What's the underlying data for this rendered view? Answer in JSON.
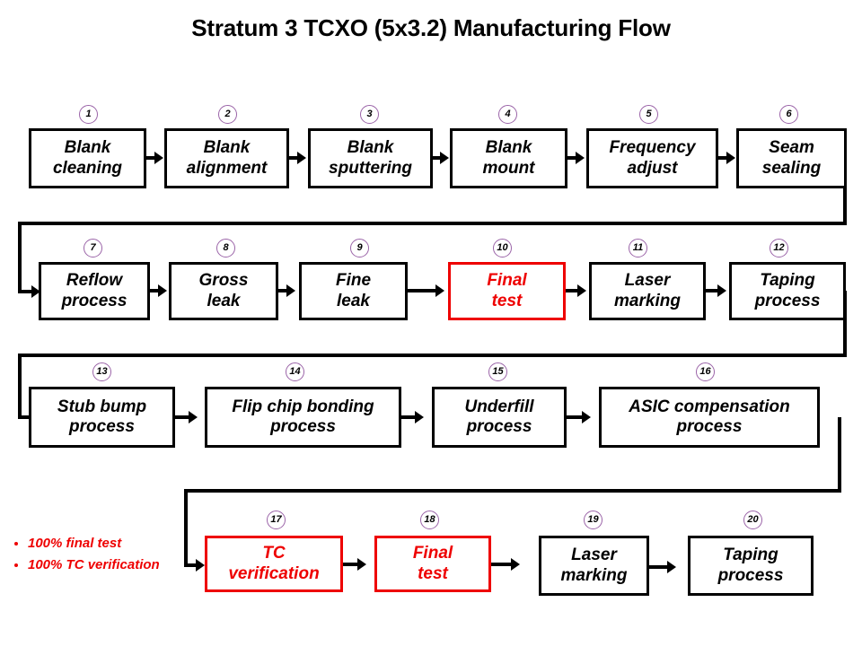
{
  "title": "Stratum 3 TCXO (5x3.2) Manufacturing Flow",
  "colors": {
    "box_border": "#000000",
    "highlight_border": "#ee0000",
    "highlight_text": "#ee0000",
    "step_circle": "#9b64a8",
    "note_text": "#ee0000",
    "connector": "#000000"
  },
  "rows": [
    {
      "id": "row-1",
      "steps": [
        {
          "num": "1",
          "label": "Blank\ncleaning",
          "highlight": false
        },
        {
          "num": "2",
          "label": "Blank\nalignment",
          "highlight": false
        },
        {
          "num": "3",
          "label": "Blank\nsputtering",
          "highlight": false
        },
        {
          "num": "4",
          "label": "Blank\nmount",
          "highlight": false
        },
        {
          "num": "5",
          "label": "Frequency\nadjust",
          "highlight": false
        },
        {
          "num": "6",
          "label": "Seam\nsealing",
          "highlight": false
        }
      ]
    },
    {
      "id": "row-2",
      "steps": [
        {
          "num": "7",
          "label": "Reflow\nprocess",
          "highlight": false
        },
        {
          "num": "8",
          "label": "Gross\nleak",
          "highlight": false
        },
        {
          "num": "9",
          "label": "Fine\nleak",
          "highlight": false
        },
        {
          "num": "10",
          "label": "Final\ntest",
          "highlight": true
        },
        {
          "num": "11",
          "label": "Laser\nmarking",
          "highlight": false
        },
        {
          "num": "12",
          "label": "Taping\nprocess",
          "highlight": false
        }
      ]
    },
    {
      "id": "row-3",
      "steps": [
        {
          "num": "13",
          "label": "Stub bump\nprocess",
          "highlight": false
        },
        {
          "num": "14",
          "label": "Flip chip bonding\nprocess",
          "highlight": false
        },
        {
          "num": "15",
          "label": "Underfill\nprocess",
          "highlight": false
        },
        {
          "num": "16",
          "label": "ASIC compensation\nprocess",
          "highlight": false
        }
      ]
    },
    {
      "id": "row-4",
      "steps": [
        {
          "num": "17",
          "label": "TC\nverification",
          "highlight": true
        },
        {
          "num": "18",
          "label": "Final\ntest",
          "highlight": true
        },
        {
          "num": "19",
          "label": "Laser\nmarking",
          "highlight": false
        },
        {
          "num": "20",
          "label": "Taping\nprocess",
          "highlight": false
        }
      ]
    }
  ],
  "notes": [
    "100% final test",
    "100% TC verification"
  ]
}
